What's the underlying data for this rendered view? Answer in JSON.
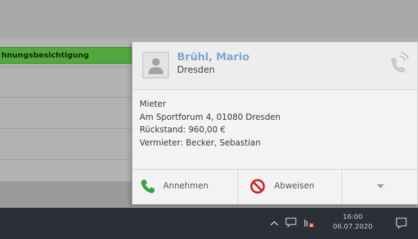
{
  "background_app": {
    "appointment_text": "hnungsbesichtigung"
  },
  "call_popup": {
    "caller_name": "Brühl, Mario",
    "caller_city": "Dresden",
    "details": [
      "Mieter",
      "Am Sportforum 4, 01080 Dresden",
      "Rückstand: 960,00 €",
      "Vermieter: Becker, Sebastian"
    ],
    "actions": {
      "accept_label": "Annehmen",
      "reject_label": "Abweisen"
    },
    "icons": {
      "avatar": "user-placeholder-icon",
      "incoming_call": "phone-ringing-icon",
      "accept": "phone-icon",
      "reject": "prohibited-icon",
      "more": "chevron-down-icon"
    },
    "colors": {
      "caller_name": "#7ba7cf",
      "accept_icon": "#3aa34a",
      "reject_icon": "#d42020",
      "appointment": "#52a83d"
    }
  },
  "taskbar": {
    "clock_time": "16:00",
    "clock_date": "06.07.2020",
    "icons": [
      "chevron-up-icon",
      "chat-icon",
      "network-icon",
      "notification-center-icon"
    ]
  }
}
